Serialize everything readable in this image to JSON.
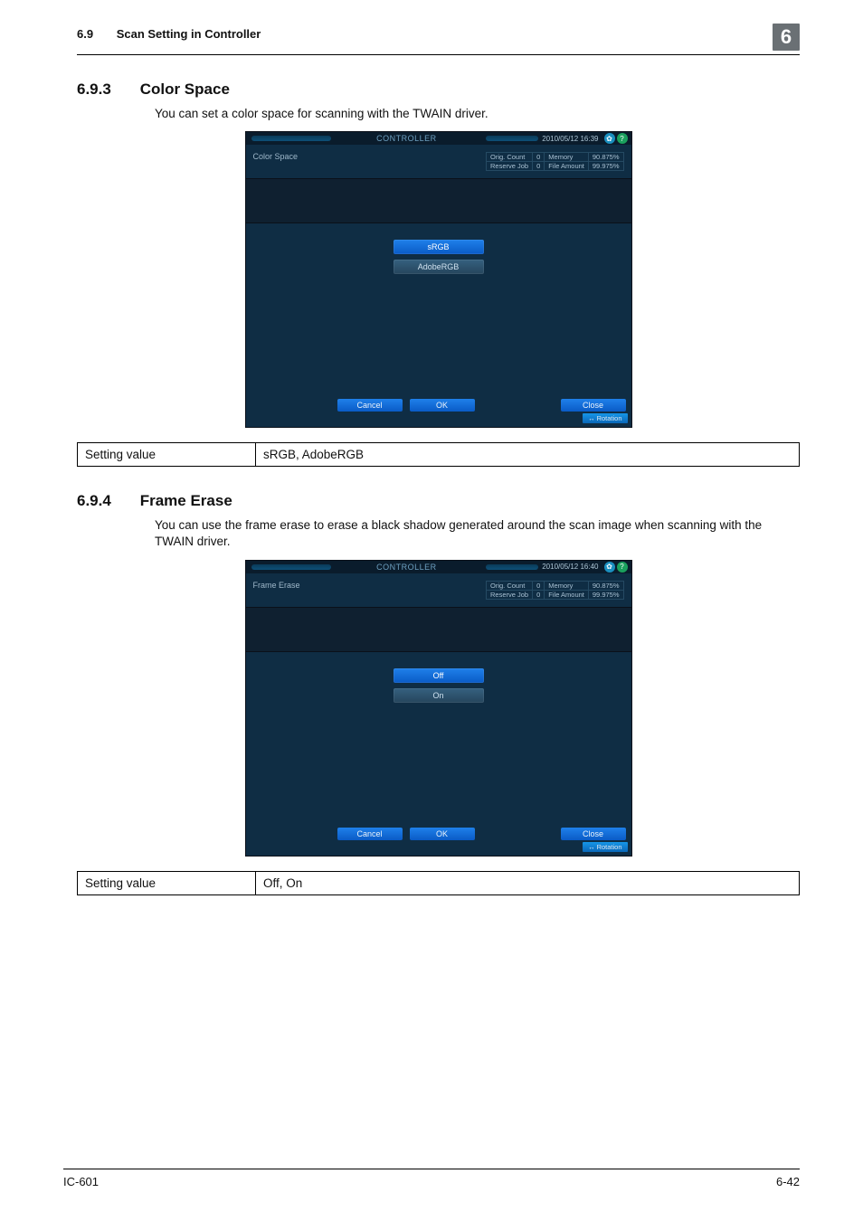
{
  "runhead": {
    "num": "6.9",
    "title": "Scan Setting in Controller",
    "chapter": "6"
  },
  "section1": {
    "num": "6.9.3",
    "title": "Color Space",
    "desc": "You can set a color space for scanning with the TWAIN driver.",
    "panel": {
      "titlebar": "CONTROLLER",
      "date": "2010/05/12 16:39",
      "label": "Color Space",
      "stats": {
        "r1a": "Orig. Count",
        "r1b": "0",
        "r1c": "Memory",
        "r1d": "90.875%",
        "r2a": "Reserve Job",
        "r2b": "0",
        "r2c": "File Amount",
        "r2d": "99.975%"
      },
      "opts": {
        "a": "sRGB",
        "b": "AdobeRGB"
      },
      "buttons": {
        "cancel": "Cancel",
        "ok": "OK",
        "close": "Close",
        "rotation": "Rotation"
      }
    },
    "table": {
      "k": "Setting value",
      "v": "sRGB, AdobeRGB"
    }
  },
  "section2": {
    "num": "6.9.4",
    "title": "Frame Erase",
    "desc": "You can use the frame erase to erase a black shadow generated around the scan image when scanning with the TWAIN driver.",
    "panel": {
      "titlebar": "CONTROLLER",
      "date": "2010/05/12 16:40",
      "label": "Frame Erase",
      "stats": {
        "r1a": "Orig. Count",
        "r1b": "0",
        "r1c": "Memory",
        "r1d": "90.875%",
        "r2a": "Reserve Job",
        "r2b": "0",
        "r2c": "File Amount",
        "r2d": "99.975%"
      },
      "opts": {
        "a": "Off",
        "b": "On"
      },
      "buttons": {
        "cancel": "Cancel",
        "ok": "OK",
        "close": "Close",
        "rotation": "Rotation"
      }
    },
    "table": {
      "k": "Setting value",
      "v": "Off, On"
    }
  },
  "footer": {
    "left": "IC-601",
    "right": "6-42"
  }
}
